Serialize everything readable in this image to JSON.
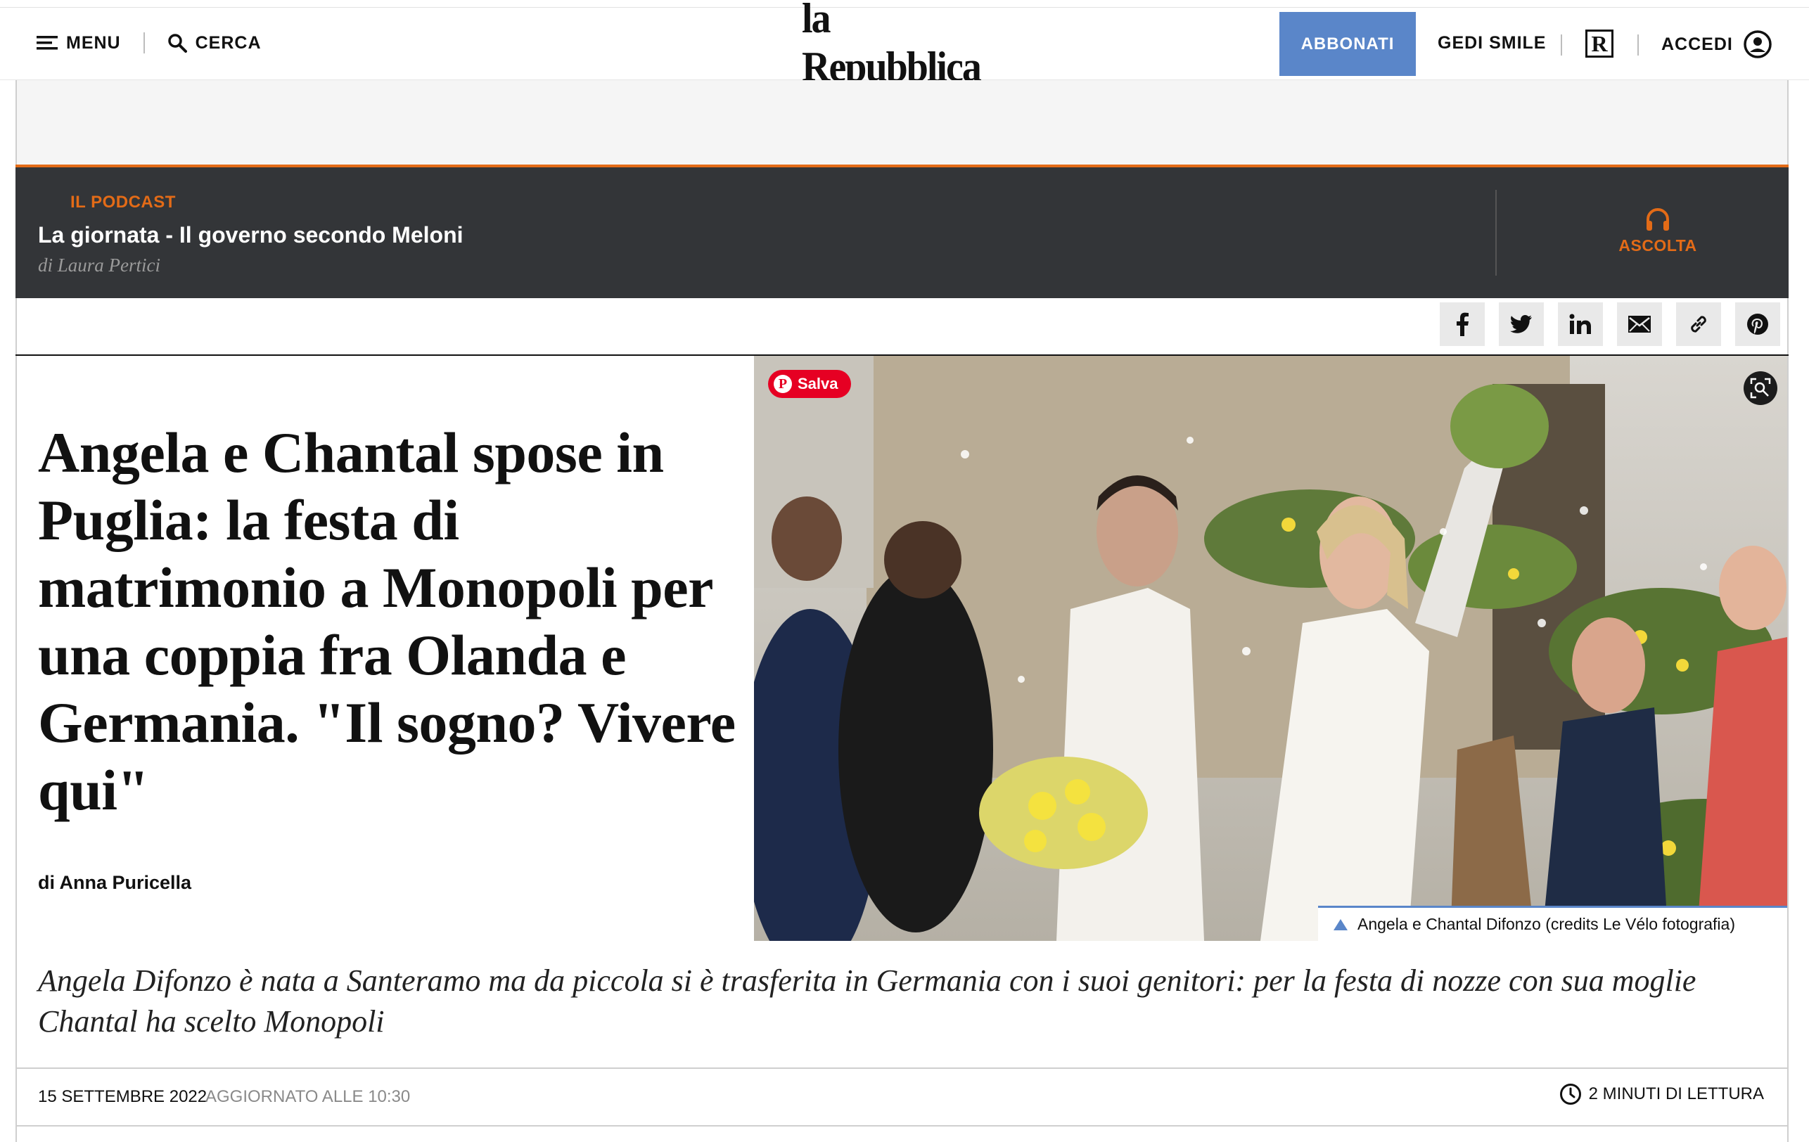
{
  "header": {
    "menu_label": "MENU",
    "search_label": "CERCA",
    "logo_text": "la Repubblica",
    "subscribe_label": "ABBONATI",
    "gedi_label": "GEDI SMILE",
    "rep_icon_letter": "R",
    "login_label": "ACCEDI"
  },
  "podcast": {
    "kicker": "IL PODCAST",
    "title": "La giornata - Il governo secondo Meloni",
    "author": "di Laura Pertici",
    "listen_label": "ASCOLTA",
    "accent_color": "#e36b17"
  },
  "share": {
    "icons": [
      "facebook-icon",
      "twitter-icon",
      "linkedin-icon",
      "mail-icon",
      "link-icon",
      "pinterest-icon"
    ]
  },
  "article": {
    "headline": "Angela e Chantal spose in Puglia: la festa di matrimonio a Monopoli per una coppia fra Olanda e Germania. \"Il sogno? Vivere qui\"",
    "byline": "di Anna Puricella",
    "photo_save_label": "Salva",
    "photo_caption": "Angela e Chantal Difonzo (credits Le Vélo fotografia)",
    "summary": "Angela Difonzo è nata a Santeramo ma da piccola si è trasferita in Germania con i suoi genitori: per la festa di nozze con sua moglie Chantal ha scelto Monopoli",
    "date": "15 SETTEMBRE 2022",
    "updated": "AGGIORNATO ALLE 10:30",
    "read_time": "2 MINUTI DI LETTURA"
  },
  "colors": {
    "subscribe_bg": "#5a86c9",
    "podcast_bg": "#333538",
    "pinterest_red": "#e60023"
  }
}
